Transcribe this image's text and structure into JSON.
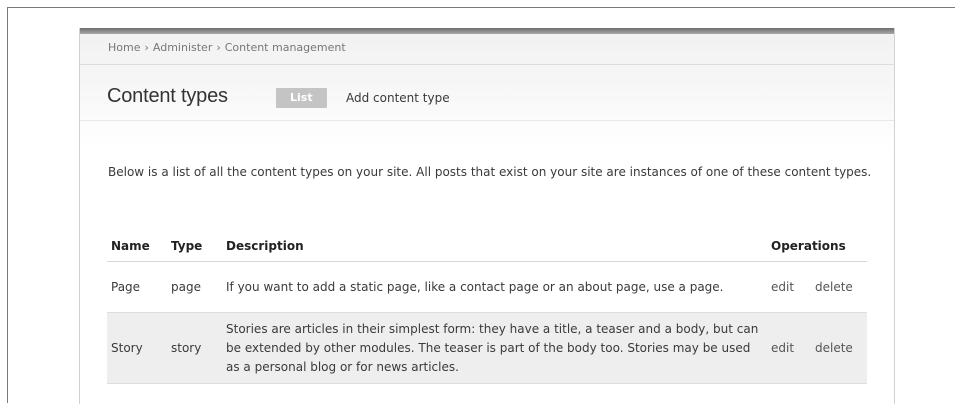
{
  "breadcrumb": {
    "items": [
      "Home",
      "Administer",
      "Content management"
    ],
    "separator": "›"
  },
  "page": {
    "title": "Content types",
    "tabs": [
      {
        "label": "List",
        "active": true
      },
      {
        "label": "Add content type",
        "active": false
      }
    ],
    "intro": "Below is a list of all the content types on your site. All posts that exist on your site are instances of one of these content types."
  },
  "table": {
    "headers": {
      "name": "Name",
      "type": "Type",
      "description": "Description",
      "operations": "Operations"
    },
    "rows": [
      {
        "name": "Page",
        "type": "page",
        "description": "If you want to add a static page, like a contact page or an about page, use a page.",
        "edit": "edit",
        "delete": "delete"
      },
      {
        "name": "Story",
        "type": "story",
        "description": "Stories are articles in their simplest form: they have a title, a teaser and a body, but can be extended by other modules. The teaser is part of the body too. Stories may be used as a personal blog or for news articles.",
        "edit": "edit",
        "delete": "delete"
      }
    ]
  },
  "colors": {
    "active_tab_bg": "#c4c4c4",
    "row_alt_bg": "#eeeeee",
    "text": "#3a3a3a"
  }
}
